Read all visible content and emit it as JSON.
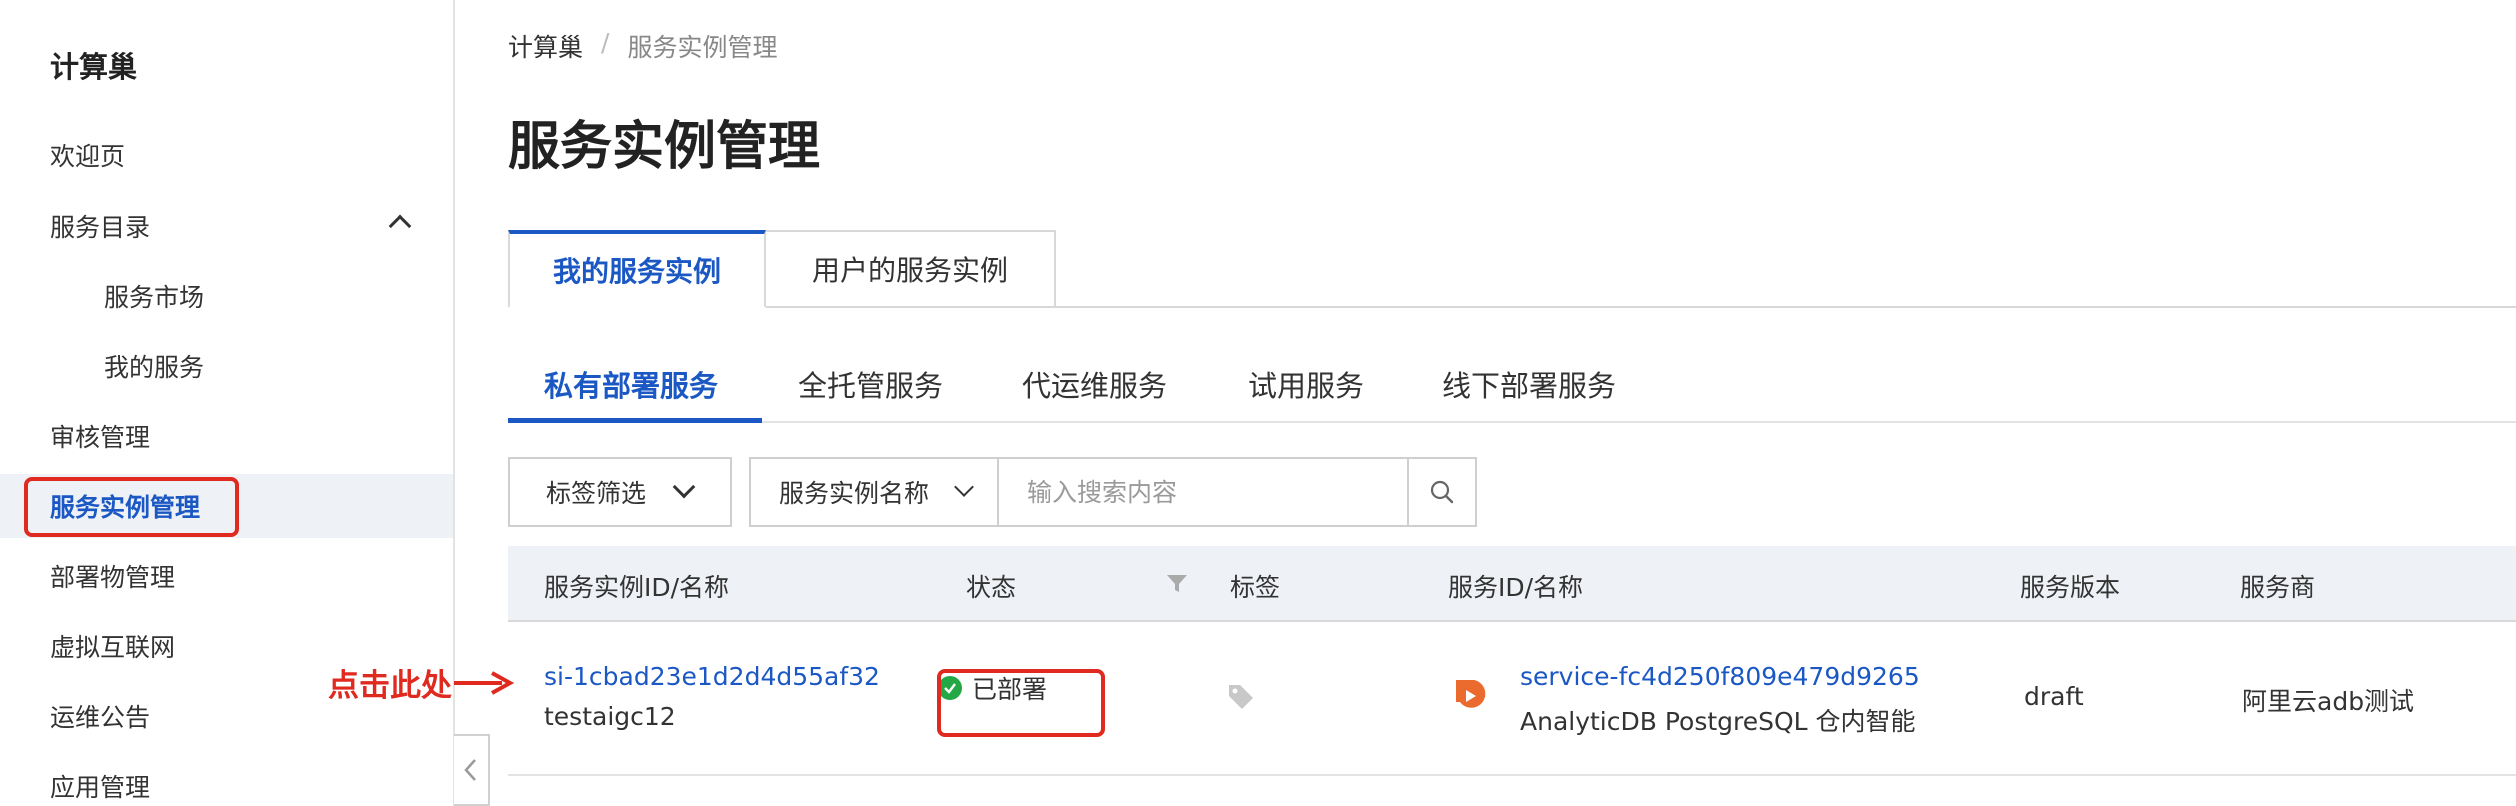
{
  "sidebar": {
    "title": "计算巢",
    "items": [
      {
        "label": "欢迎页"
      },
      {
        "label": "服务目录"
      },
      {
        "label": "服务市场"
      },
      {
        "label": "我的服务"
      },
      {
        "label": "审核管理"
      },
      {
        "label": "服务实例管理"
      },
      {
        "label": "部署物管理"
      },
      {
        "label": "虚拟互联网"
      },
      {
        "label": "运维公告"
      },
      {
        "label": "应用管理"
      }
    ]
  },
  "breadcrumb": {
    "root": "计算巢",
    "sep": "/",
    "current": "服务实例管理"
  },
  "page_title": "服务实例管理",
  "primary_tabs": [
    {
      "label": "我的服务实例"
    },
    {
      "label": "用户的服务实例"
    }
  ],
  "secondary_tabs": [
    {
      "label": "私有部署服务"
    },
    {
      "label": "全托管服务"
    },
    {
      "label": "代运维服务"
    },
    {
      "label": "试用服务"
    },
    {
      "label": "线下部署服务"
    }
  ],
  "filters": {
    "tag_filter_label": "标签筛选",
    "search_field_label": "服务实例名称",
    "search_placeholder": "输入搜索内容"
  },
  "table": {
    "columns": [
      "服务实例ID/名称",
      "状态",
      "标签",
      "服务ID/名称",
      "服务版本",
      "服务商"
    ],
    "rows": [
      {
        "instance_id": "si-1cbad23e1d2d4d55af32",
        "instance_name": "testaigc12",
        "status": "已部署",
        "service_id": "service-fc4d250f809e479d9265",
        "service_name": "AnalyticDB PostgreSQL 仓内智能",
        "version": "draft",
        "provider": "阿里云adb测试"
      }
    ]
  },
  "annotation": {
    "text": "点击此处"
  },
  "colors": {
    "accent": "#1b58c4",
    "highlight": "#e02a1f",
    "status_ok": "#23a845",
    "service_icon": "#ea6b2d"
  }
}
